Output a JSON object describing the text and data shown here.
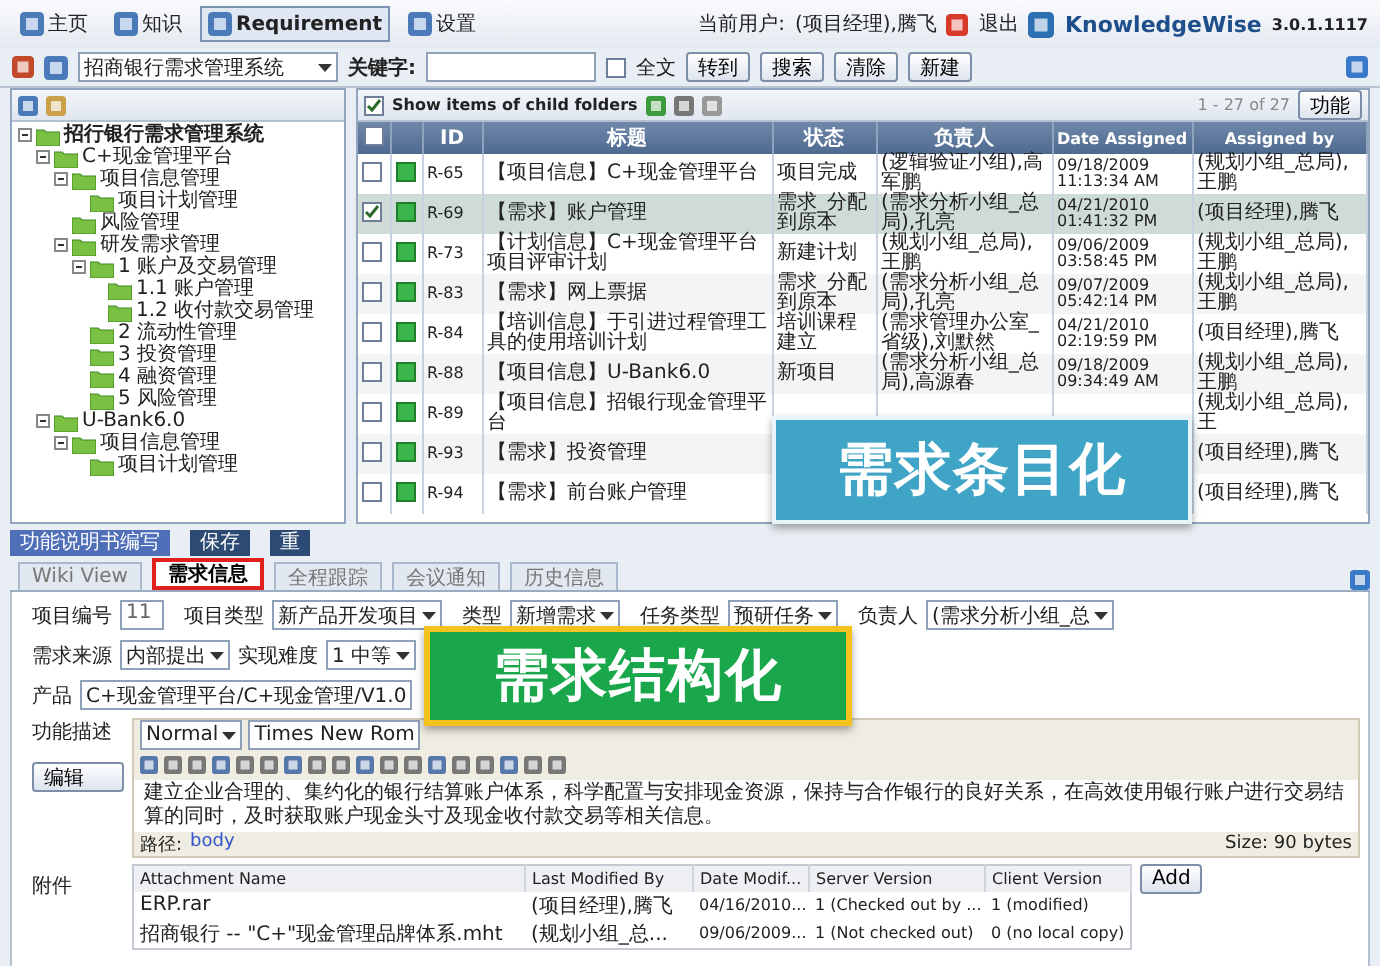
{
  "nav": {
    "items": [
      {
        "label": "主页",
        "selected": false
      },
      {
        "label": "知识",
        "selected": false
      },
      {
        "label": "Requirement",
        "selected": true
      },
      {
        "label": "设置",
        "selected": false
      }
    ],
    "user_label": "当前用户:",
    "user": "(项目经理),腾飞",
    "logout": "退出",
    "brand": "KnowledgeWise",
    "version": "3.0.1.1117"
  },
  "toolbar": {
    "system": "招商银行需求管理系统",
    "keyword_label": "关键字:",
    "fulltext_label": "全文",
    "fulltext_checked": false,
    "buttons": [
      "转到",
      "搜索",
      "清除",
      "新建"
    ]
  },
  "tree": [
    {
      "label": "招行银行需求管理系统",
      "expanded": true,
      "children": [
        {
          "label": "C+现金管理平台",
          "expanded": true,
          "children": [
            {
              "label": "项目信息管理",
              "expanded": true,
              "children": [
                {
                  "label": "项目计划管理"
                }
              ]
            },
            {
              "label": "风险管理"
            },
            {
              "label": "研发需求管理",
              "expanded": true,
              "children": [
                {
                  "label": "1 账户及交易管理",
                  "expanded": true,
                  "children": [
                    {
                      "label": "1.1 账户管理"
                    },
                    {
                      "label": "1.2 收付款交易管理"
                    }
                  ]
                },
                {
                  "label": "2 流动性管理"
                },
                {
                  "label": "3 投资管理"
                },
                {
                  "label": "4 融资管理"
                },
                {
                  "label": "5 风险管理"
                }
              ]
            }
          ]
        },
        {
          "label": "U-Bank6.0",
          "expanded": true,
          "children": [
            {
              "label": "项目信息管理",
              "expanded": true,
              "children": [
                {
                  "label": "项目计划管理"
                }
              ]
            }
          ]
        }
      ]
    }
  ],
  "list": {
    "all_checked": false,
    "show_child_label": "Show items of child folders",
    "show_child_checked": true,
    "pager": "1 - 27 of 27",
    "function_button": "功能",
    "columns": [
      "ID",
      "标题",
      "状态",
      "负责人",
      "Date Assigned",
      "Assigned by"
    ],
    "rows": [
      {
        "id": "R-65",
        "title": "【项目信息】C+现金管理平台",
        "status": "项目完成",
        "owner": "(逻辑验证小组),高军鹏",
        "date": "09/18/2009 11:13:34 AM",
        "assigned_by": "(规划小组_总局),王鹏",
        "checked": false,
        "selected": false
      },
      {
        "id": "R-69",
        "title": "【需求】账户管理",
        "status": "需求_分配到原本",
        "owner": "(需求分析小组_总局),孔亮",
        "date": "04/21/2010 01:41:32 PM",
        "assigned_by": "(项目经理),腾飞",
        "checked": true,
        "selected": true
      },
      {
        "id": "R-73",
        "title": "【计划信息】C+现金管理平台项目评审计划",
        "status": "新建计划",
        "owner": "(规划小组_总局),王鹏",
        "date": "09/06/2009 03:58:45 PM",
        "assigned_by": "(规划小组_总局),王鹏",
        "checked": false,
        "selected": false
      },
      {
        "id": "R-83",
        "title": "【需求】网上票据",
        "status": "需求_分配到原本",
        "owner": "(需求分析小组_总局),孔亮",
        "date": "09/07/2009 05:42:14 PM",
        "assigned_by": "(规划小组_总局),王鹏",
        "checked": false,
        "selected": false
      },
      {
        "id": "R-84",
        "title": "【培训信息】于引进过程管理工具的使用培训计划",
        "status": "培训课程建立",
        "owner": "(需求管理办公室_省级),刘默然",
        "date": "04/21/2010 02:19:59 PM",
        "assigned_by": "(项目经理),腾飞",
        "checked": false,
        "selected": false
      },
      {
        "id": "R-88",
        "title": "【项目信息】U-Bank6.0",
        "status": "新项目",
        "owner": "(需求分析小组_总局),高源春",
        "date": "09/18/2009 09:34:49 AM",
        "assigned_by": "(规划小组_总局),王鹏",
        "checked": false,
        "selected": false
      },
      {
        "id": "R-89",
        "title": "【项目信息】招银行现金管理平台",
        "assigned_by": "(规划小组_总局),王",
        "checked": false,
        "selected": false
      },
      {
        "id": "R-93",
        "title": "【需求】投资管理",
        "assigned_by": "(项目经理),腾飞",
        "checked": false,
        "selected": false
      },
      {
        "id": "R-94",
        "title": "【需求】前台账户管理",
        "assigned_by": "(项目经理),腾飞",
        "checked": false,
        "selected": false
      }
    ]
  },
  "detail": {
    "header_buttons": [
      "功能说明书编写",
      "保存",
      "重"
    ],
    "tabs": [
      {
        "label": "Wiki View",
        "selected": false,
        "highlighted": false
      },
      {
        "label": "需求信息",
        "selected": true,
        "highlighted": true
      },
      {
        "label": "全程跟踪",
        "selected": false,
        "highlighted": false
      },
      {
        "label": "会议通知",
        "selected": false,
        "highlighted": false
      },
      {
        "label": "历史信息",
        "selected": false,
        "highlighted": false
      }
    ],
    "fields": [
      {
        "label": "项目编号",
        "value": "11"
      },
      {
        "label": "项目类型",
        "value": "新产品开发项目"
      },
      {
        "label": "类型",
        "value": "新增需求"
      },
      {
        "label": "任务类型",
        "value": "预研任务"
      },
      {
        "label": "负责人",
        "value": "(需求分析小组_总"
      },
      {
        "label": "需求来源",
        "value": "内部提出"
      },
      {
        "label": "实现难度",
        "value": "1 中等"
      }
    ],
    "product_label": "产品",
    "product": "C+现金管理平台/C+现金管理/V1.0",
    "description_label": "功能描述",
    "edit_button": "编辑",
    "style": "Normal",
    "font": "Times New Rom",
    "content": "建立企业合理的、集约化的银行结算账户体系，科学配置与安排现金资源，保持与合作银行的良好关系，在高效使用银行账户进行交易结算的同时，及时获取账户现金头寸及现金收付款交易等相关信息。",
    "path_label": "路径:",
    "path": "body",
    "size": "Size: 90 bytes",
    "attachments_label": "附件",
    "add_button": "Add",
    "attachment_columns": [
      "Attachment Name",
      "Last Modified By",
      "Date Modif...",
      "Server Version",
      "Client Version"
    ],
    "attachments": [
      [
        "ERP.rar",
        "(项目经理),腾飞",
        "04/16/2010...",
        "1 (Checked out by ...",
        "1 (modified)"
      ],
      [
        "招商银行 -- \"C+\"现金管理品牌体系.mht",
        "(规划小组_总...",
        "09/06/2009...",
        "1 (Not checked out)",
        "0 (no local copy)"
      ]
    ]
  },
  "callouts": [
    {
      "text": "需求条目化",
      "color": "#3fa4c6"
    },
    {
      "text": "需求结构化",
      "color": "#1aa64a"
    }
  ]
}
